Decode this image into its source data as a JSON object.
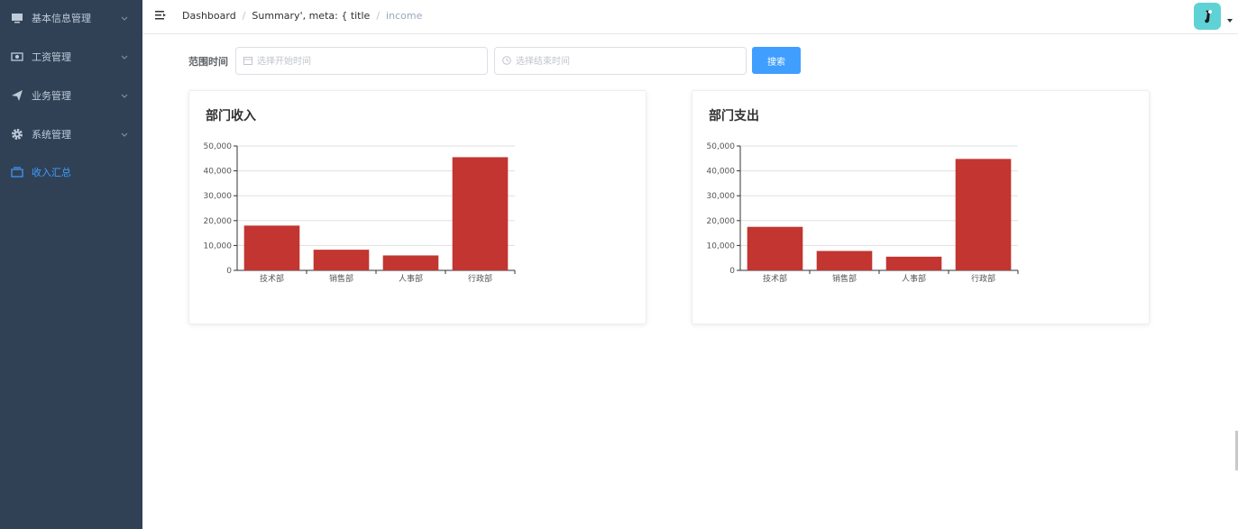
{
  "sidebar": {
    "items": [
      {
        "label": "基本信息管理",
        "icon": "monitor-icon",
        "expandable": true,
        "active": false
      },
      {
        "label": "工资管理",
        "icon": "money-icon",
        "expandable": true,
        "active": false
      },
      {
        "label": "业务管理",
        "icon": "send-icon",
        "expandable": true,
        "active": false
      },
      {
        "label": "系统管理",
        "icon": "gear-icon",
        "expandable": true,
        "active": false
      },
      {
        "label": "收入汇总",
        "icon": "wallet-icon",
        "expandable": false,
        "active": true
      }
    ]
  },
  "navbar": {
    "breadcrumb": [
      {
        "label": "Dashboard"
      },
      {
        "label": "Summary', meta: { title"
      },
      {
        "label": "income"
      }
    ],
    "separator": "/",
    "avatar": "avatar-image-icon"
  },
  "filter": {
    "label": "范围时间",
    "start_placeholder": "选择开始时间",
    "end_placeholder": "选择结束时间",
    "search_label": "搜索"
  },
  "cards": [
    {
      "title": "部门收入"
    },
    {
      "title": "部门支出"
    }
  ],
  "colors": {
    "sidebar_bg": "#304156",
    "sidebar_text": "#bfcbd9",
    "active_text": "#409eff",
    "button_bg": "#409eff",
    "bar_color": "#c23531",
    "avatar_bg": "#5fd2d6"
  },
  "chart_data": [
    {
      "type": "bar",
      "categories": [
        "技术部",
        "销售部",
        "人事部",
        "行政部"
      ],
      "values": [
        18000,
        8300,
        6000,
        45500
      ],
      "yticks": [
        "0",
        "10,000",
        "20,000",
        "30,000",
        "40,000",
        "50,000"
      ],
      "ylim": [
        0,
        50000
      ],
      "grid": true,
      "color": "#c23531"
    },
    {
      "type": "bar",
      "categories": [
        "技术部",
        "销售部",
        "人事部",
        "行政部"
      ],
      "values": [
        17500,
        7800,
        5500,
        44800
      ],
      "yticks": [
        "0",
        "10,000",
        "20,000",
        "30,000",
        "40,000",
        "50,000"
      ],
      "ylim": [
        0,
        50000
      ],
      "grid": true,
      "color": "#c23531"
    }
  ]
}
